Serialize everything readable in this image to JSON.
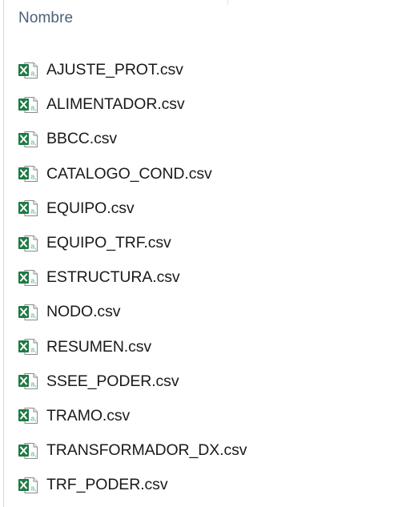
{
  "header": {
    "column_label": "Nombre"
  },
  "icon": {
    "name": "excel-csv-file-icon",
    "accent": "#1f7a45",
    "accent_light": "#63b47a"
  },
  "files": [
    {
      "name": "AJUSTE_PROT.csv"
    },
    {
      "name": "ALIMENTADOR.csv"
    },
    {
      "name": "BBCC.csv"
    },
    {
      "name": "CATALOGO_COND.csv"
    },
    {
      "name": "EQUIPO.csv"
    },
    {
      "name": "EQUIPO_TRF.csv"
    },
    {
      "name": "ESTRUCTURA.csv"
    },
    {
      "name": "NODO.csv"
    },
    {
      "name": "RESUMEN.csv"
    },
    {
      "name": "SSEE_PODER.csv"
    },
    {
      "name": "TRAMO.csv"
    },
    {
      "name": "TRANSFORMADOR_DX.csv"
    },
    {
      "name": "TRF_PODER.csv"
    }
  ]
}
